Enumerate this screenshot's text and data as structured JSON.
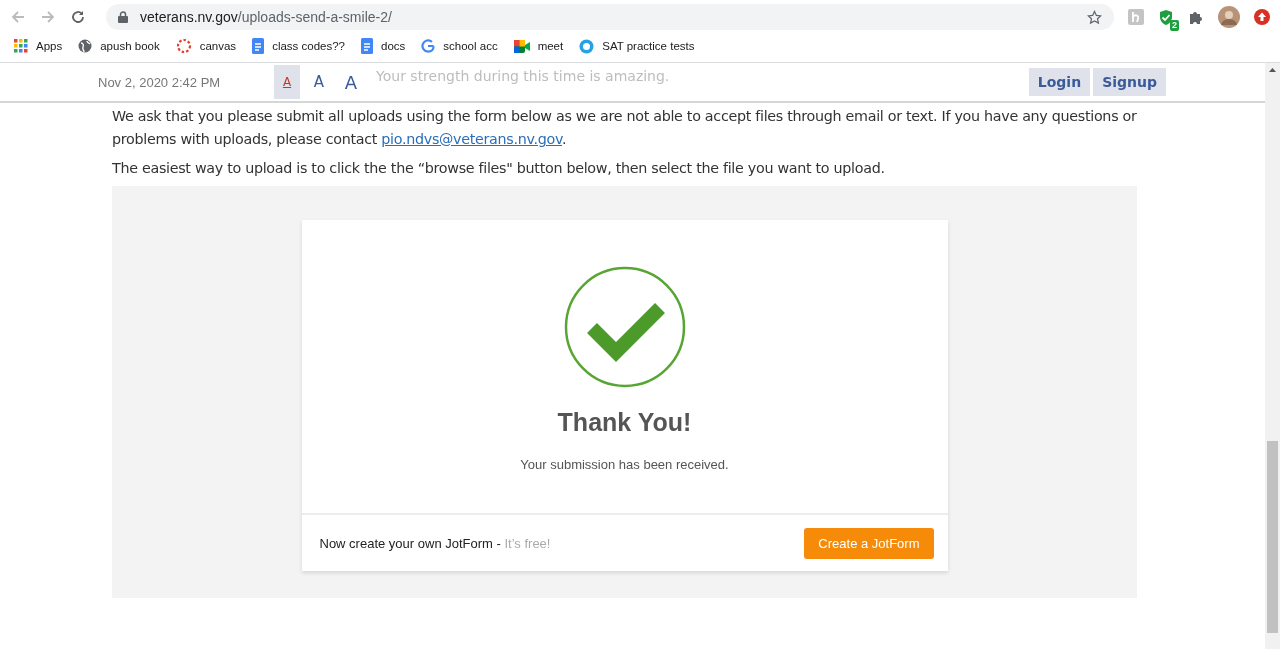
{
  "browser": {
    "url_host": "veterans.nv.gov",
    "url_path": "/uploads-send-a-smile-2/",
    "extension_badge": "2",
    "bookmarks": [
      {
        "label": "Apps",
        "kind": "apps"
      },
      {
        "label": "apush book",
        "kind": "globe"
      },
      {
        "label": "canvas",
        "kind": "canvas"
      },
      {
        "label": "class codes??",
        "kind": "doc"
      },
      {
        "label": "docs",
        "kind": "doc"
      },
      {
        "label": "school acc",
        "kind": "google"
      },
      {
        "label": "meet",
        "kind": "meet"
      },
      {
        "label": "SAT practice tests",
        "kind": "sat"
      }
    ]
  },
  "header": {
    "date": "Nov 2, 2020 2:42 PM",
    "font_sizes": [
      {
        "label": "A",
        "selected": true
      },
      {
        "label": "A",
        "selected": false
      },
      {
        "label": "A",
        "selected": false
      }
    ],
    "buttons": [
      "Login",
      "Signup"
    ]
  },
  "article": {
    "faded_line": "Your strength during this time is amazing.",
    "paragraph": "We ask that you please submit all uploads using the form below as we are not able to accept files through email or text. If you have any questions or problems with uploads, please contact ",
    "email": "pio.ndvs@veterans.nv.gov",
    "paragraph_end": ".",
    "instructions": "The easiest way to upload is to click the the “browse files\" button below, then select the file you want to upload."
  },
  "form": {
    "title": "Thank You!",
    "message": "Your submission has been received.",
    "promo": "Now create your own JotForm - ",
    "promo_note": "It’s free!",
    "cta": "Create a JotForm"
  }
}
